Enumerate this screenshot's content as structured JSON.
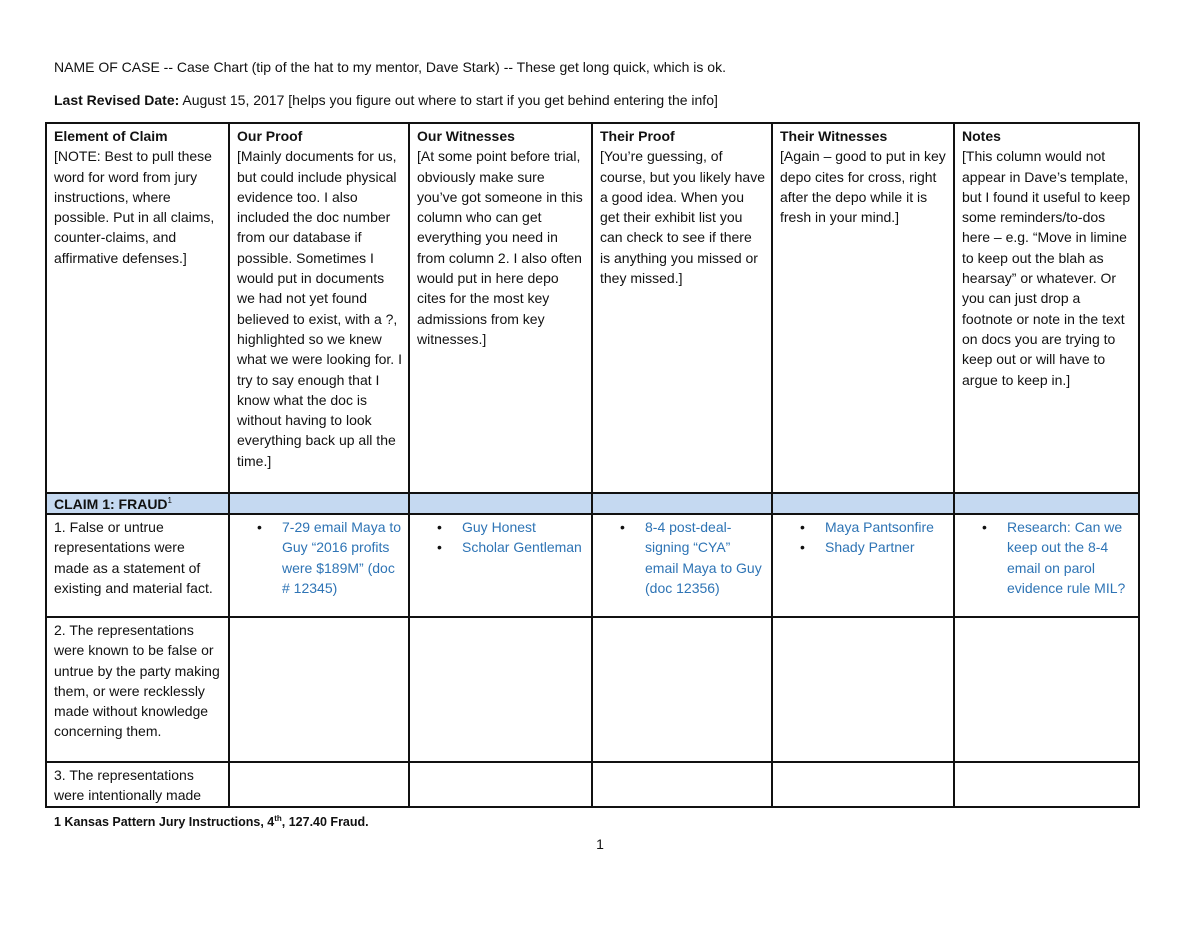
{
  "document": {
    "title_line": "NAME OF CASE -- Case Chart (tip of the hat to my mentor, Dave Stark)  --  These get long quick, which is ok.",
    "revised_label": "Last Revised Date:",
    "revised_value": " August 15, 2017  [helps you figure out where to start if you get behind entering the info]"
  },
  "table": {
    "columns": [
      {
        "title": "Element of Claim",
        "note": "[NOTE: Best to pull these word for word from jury instructions, where possible.  Put in all claims, counter-claims, and affirmative defenses.]"
      },
      {
        "title": "Our Proof",
        "note": "[Mainly documents for us, but could include physical evidence too.  I also included the doc number from our database if possible.  Sometimes I would put in documents we had not yet found believed to exist, with a ?, highlighted so we knew what we were looking for.  I try to say enough that I know what the doc is without having to look everything back up all the time.]"
      },
      {
        "title": "Our Witnesses",
        "note": "[At some point before trial, obviously make sure you’ve got someone in this column who can get everything you need in from column 2.  I also often would put in here depo cites for the most key admissions from key witnesses.]"
      },
      {
        "title": "Their Proof",
        "note": "[You’re guessing, of course, but you likely have a good idea.  When you get their exhibit list you can check to see if there is anything you missed or they missed.]"
      },
      {
        "title": "Their Witnesses",
        "note": "[Again – good to put in key depo cites for cross, right after the depo while it is fresh in your mind.]"
      },
      {
        "title": "Notes",
        "note": "[This column would not appear in Dave’s template, but I found it useful to keep some reminders/to-dos here – e.g. “Move in limine to keep out the blah as hearsay” or whatever.  Or you can just drop a footnote or note in the text on docs you are trying to keep out or will have to argue to keep in.]"
      }
    ],
    "claim": {
      "label": "CLAIM 1: FRAUD",
      "footnote_ref": "1"
    },
    "elements": [
      {
        "text": "1.  False or untrue representations were made as a statement of existing and material fact.",
        "our_proof": [
          "7-29 email Maya to Guy “2016 profits were $189M” (doc # 12345)"
        ],
        "our_witnesses": [
          "Guy Honest",
          "Scholar Gentleman"
        ],
        "their_proof": [
          "8-4 post-deal-signing “CYA” email Maya to Guy (doc 12356)"
        ],
        "their_witnesses": [
          "Maya Pantsonfire",
          "Shady Partner"
        ],
        "notes": [
          "Research: Can we keep out the 8-4 email on parol evidence rule MIL?"
        ]
      },
      {
        "text": "2.  The representations were known to be false or untrue by the party making them, or were recklessly made without knowledge concerning them."
      },
      {
        "text": "3.  The representations were intentionally made"
      }
    ]
  },
  "footnote": {
    "number": "1",
    "text_before": " Kansas Pattern Jury Instructions, 4",
    "superscript": "th",
    "text_after": ", 127.40 Fraud."
  },
  "page_number": "1",
  "colors": {
    "link_blue": "#2E74B5",
    "claim_row_bg": "#C5D9F1"
  }
}
